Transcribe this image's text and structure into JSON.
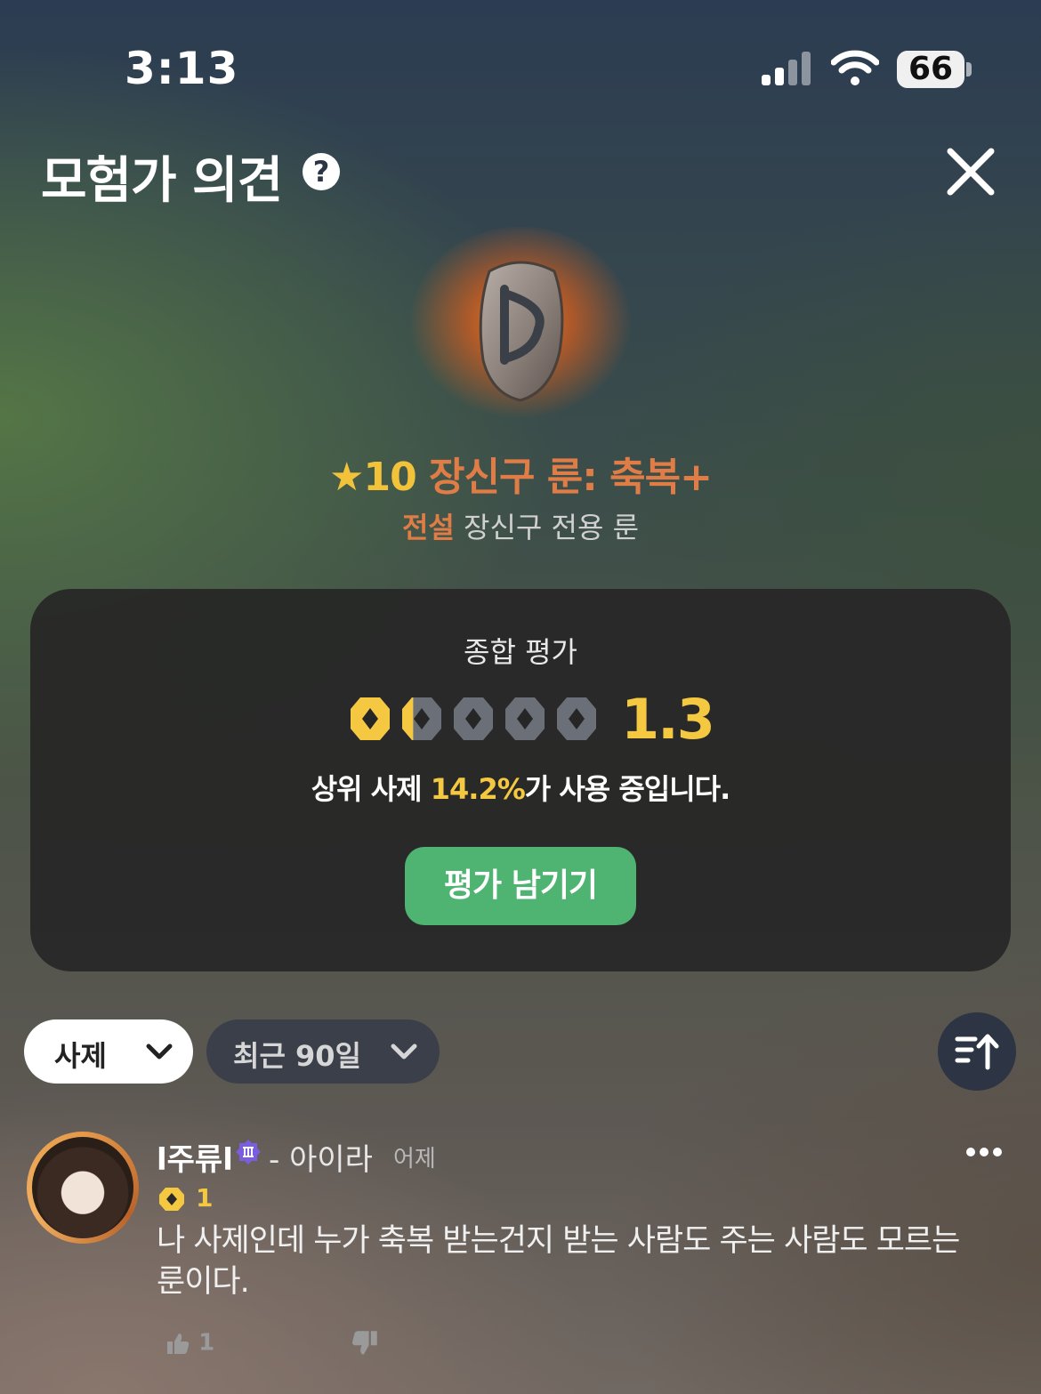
{
  "status_bar": {
    "time": "3:13",
    "battery": "66"
  },
  "header": {
    "title": "모험가 의견",
    "help_glyph": "?"
  },
  "item": {
    "star": "★",
    "level": "10",
    "name": " 장신구 룬: 축복+",
    "grade": "전설",
    "type": " 장신구 전용 룬"
  },
  "summary": {
    "title": "종합 평가",
    "score": "1.3",
    "rating_value": 1.3,
    "rating_max": 5,
    "usage_prefix": "상위 사제 ",
    "usage_percent": "14.2%",
    "usage_suffix": "가 사용 중입니다.",
    "rate_button": "평가 남기기"
  },
  "filters": {
    "class": "사제",
    "period": "최근 90일"
  },
  "comment": {
    "name": "l주류l",
    "server": "- 아이라",
    "date": "어제",
    "rating": "1",
    "text": "나 사제인데 누가 축복 받는건지 받는 사람도 주는 사람도 모르는 룬이다.",
    "likes": "1"
  },
  "colors": {
    "accent_green": "#4fb472",
    "rating_gold": "#f5c842",
    "legendary_orange": "#e07c45"
  }
}
